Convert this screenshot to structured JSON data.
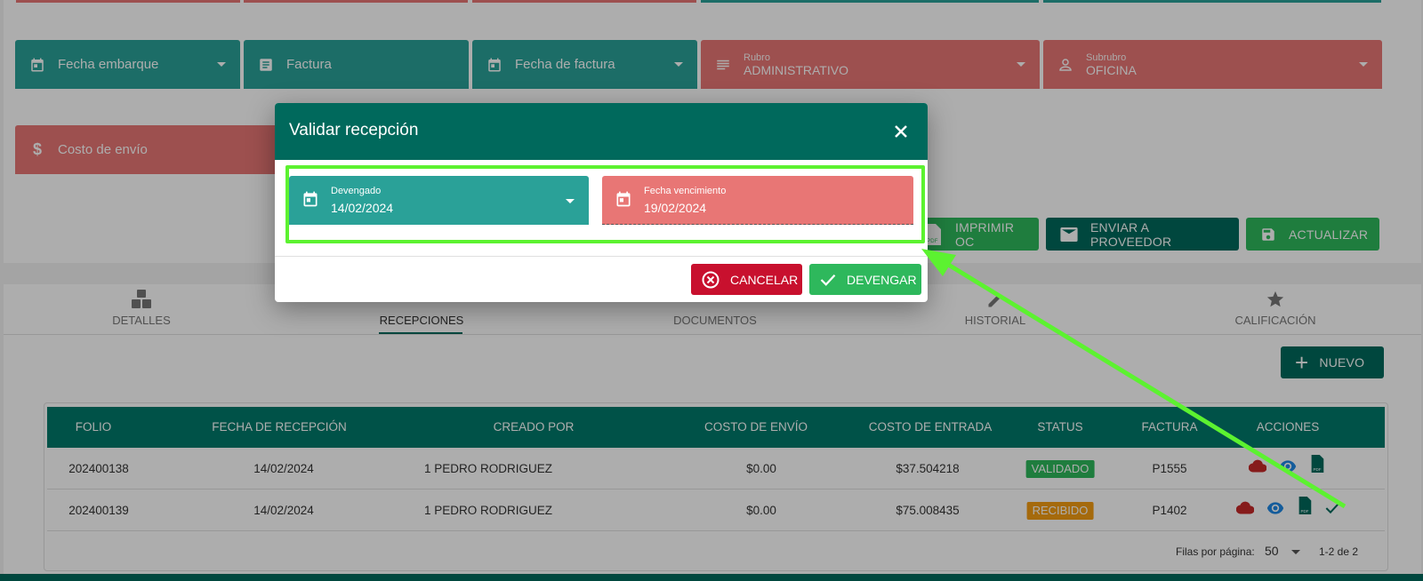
{
  "form": {
    "fecha_embarque": "Fecha embarque",
    "factura": "Factura",
    "fecha_factura": "Fecha de factura",
    "rubro_label": "Rubro",
    "rubro_value": "ADMINISTRATIVO",
    "subrubro_label": "Subrubro",
    "subrubro_value": "OFICINA",
    "costo_envio": "Costo de envío"
  },
  "actions": {
    "imprimir": "IMPRIMIR OC",
    "enviar": "ENVIAR A PROVEEDOR",
    "actualizar": "ACTUALIZAR"
  },
  "tabs": [
    {
      "label": "DETALLES",
      "icon": "cubes-icon"
    },
    {
      "label": "RECEPCIONES",
      "icon": "boxes-icon"
    },
    {
      "label": "DOCUMENTOS",
      "icon": "document-icon"
    },
    {
      "label": "HISTORIAL",
      "icon": "pencil-icon"
    },
    {
      "label": "CALIFICACIÓN",
      "icon": "star-icon"
    }
  ],
  "nuevo_label": "NUEVO",
  "table": {
    "headers": [
      "FOLIO",
      "FECHA DE RECEPCIÓN",
      "CREADO POR",
      "COSTO DE ENVÍO",
      "COSTO DE ENTRADA",
      "STATUS",
      "FACTURA",
      "ACCIONES"
    ],
    "rows": [
      {
        "folio": "202400138",
        "fecha": "14/02/2024",
        "creado": "1 PEDRO RODRIGUEZ",
        "envio": "$0.00",
        "entrada": "$37.504218",
        "status": "VALIDADO",
        "factura": "P1555"
      },
      {
        "folio": "202400139",
        "fecha": "14/02/2024",
        "creado": "1 PEDRO RODRIGUEZ",
        "envio": "$0.00",
        "entrada": "$75.008435",
        "status": "RECIBIDO",
        "factura": "P1402"
      }
    ],
    "rows_per_page_label": "Filas por página:",
    "rows_per_page": "50",
    "pagination": "1-2 de 2"
  },
  "dialog": {
    "title": "Validar recepción",
    "devengado_label": "Devengado",
    "devengado_value": "14/02/2024",
    "vencimiento_label": "Fecha vencimiento",
    "vencimiento_value": "19/02/2024",
    "cancel": "CANCELAR",
    "confirm": "DEVENGAR"
  },
  "colors": {
    "teal": "#2aa198",
    "dark_teal": "#00695c",
    "red_field": "#e87675",
    "cancel": "#d32f2f",
    "confirm": "#2eb85c",
    "highlight": "#5cf230"
  }
}
